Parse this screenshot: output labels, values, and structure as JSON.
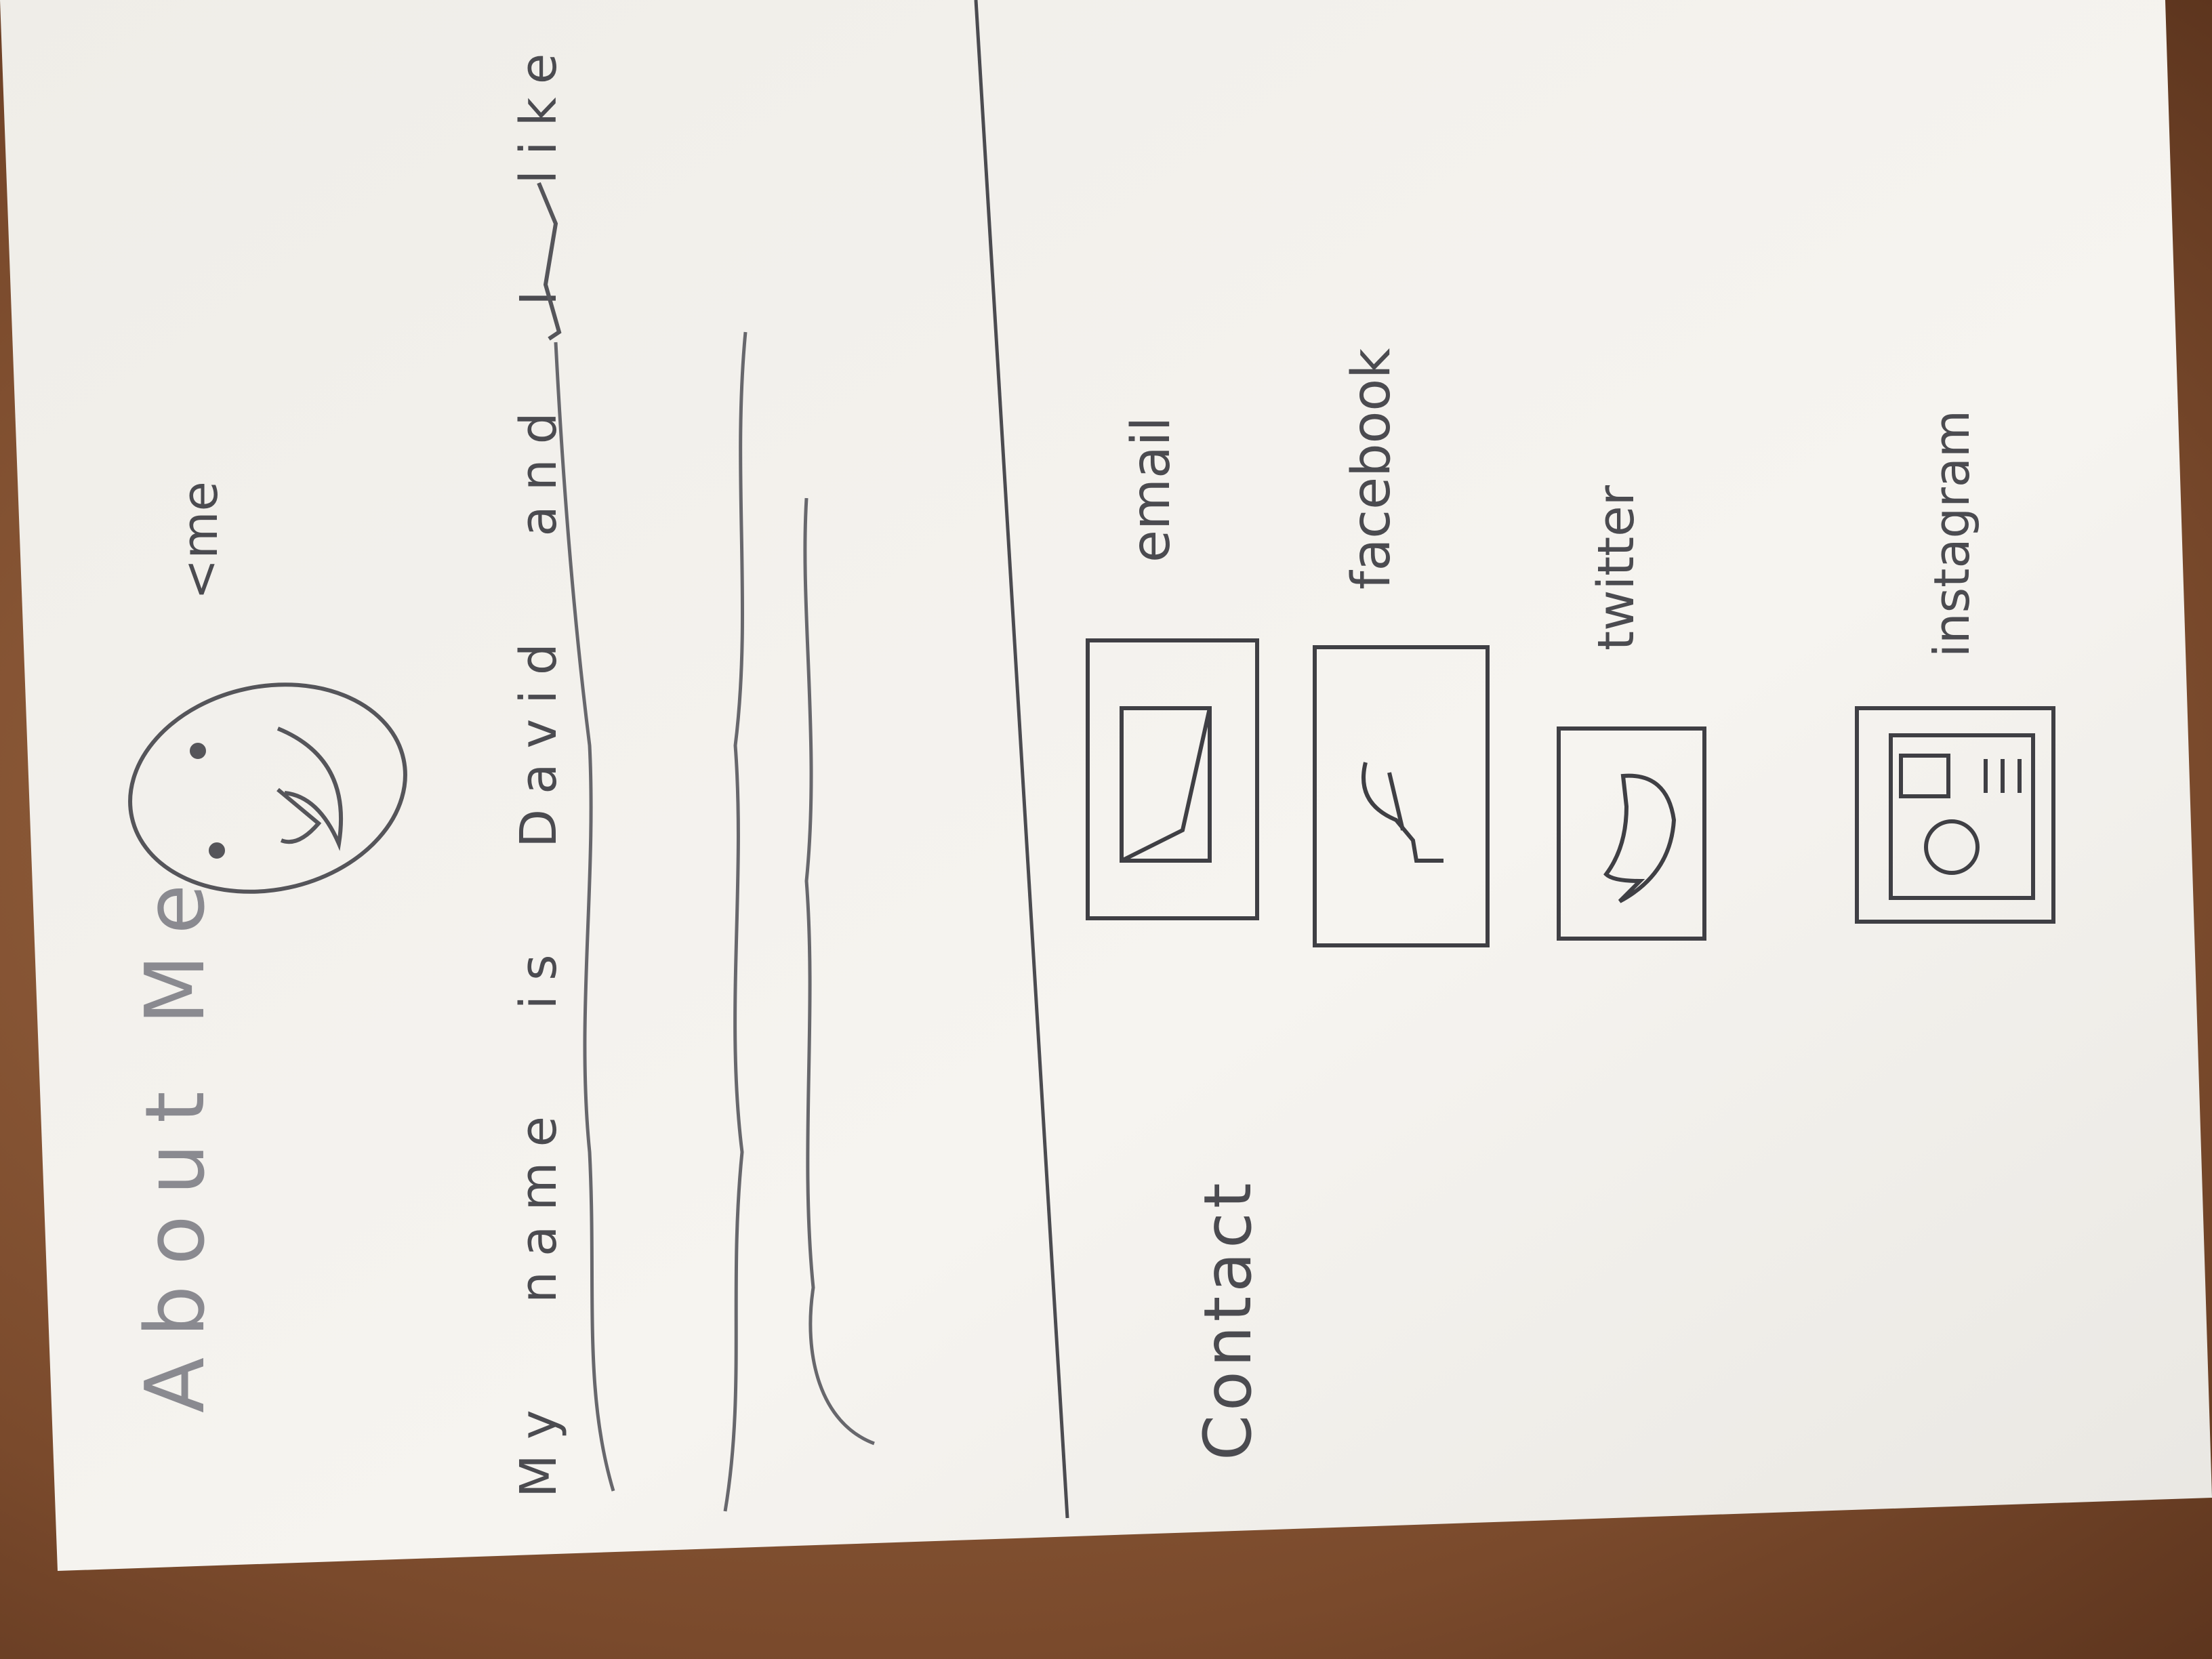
{
  "sketch": {
    "about_title": "About Me",
    "me_label": "<me",
    "intro_text": "My name is David and I like to code",
    "contact_title": "Contact",
    "contacts": [
      {
        "label": "email",
        "icon": "envelope-icon"
      },
      {
        "label": "facebook",
        "icon": "facebook-icon"
      },
      {
        "label": "twitter",
        "icon": "twitter-bird-icon"
      },
      {
        "label": "instagram",
        "icon": "instagram-camera-icon"
      }
    ]
  },
  "colors": {
    "paper": "#f4f2ee",
    "pencil": "#4b4b50",
    "table_wood": "#8f5e3c"
  }
}
